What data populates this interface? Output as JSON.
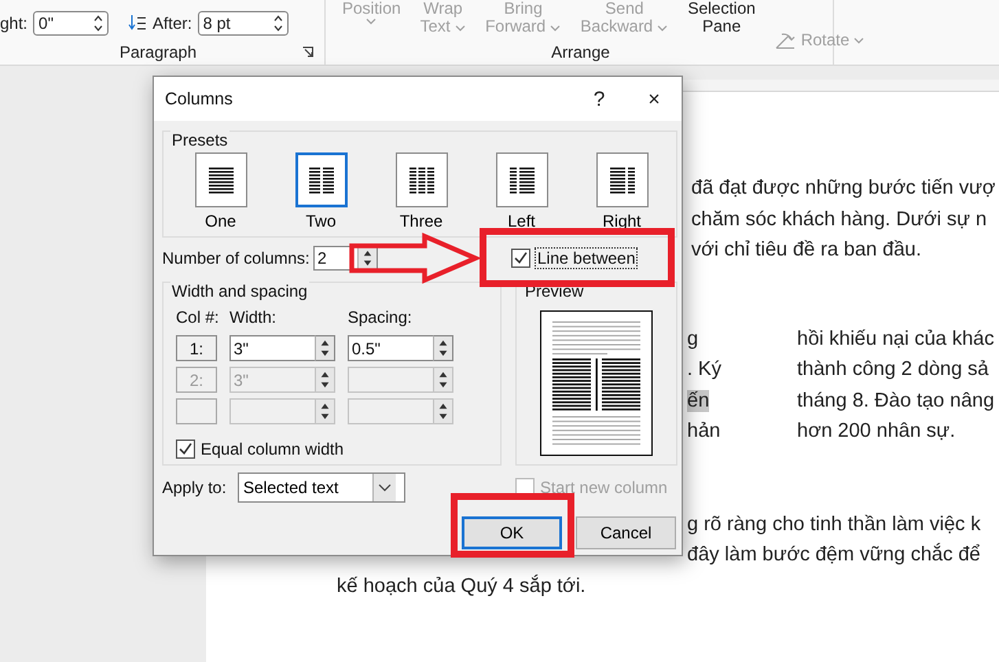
{
  "ribbon": {
    "paragraph": {
      "indent": {
        "label": "ght:",
        "value": "0\""
      },
      "spacing_after": {
        "label": "After:",
        "value": "8 pt"
      },
      "group_label": "Paragraph"
    },
    "arrange": {
      "group_label": "Arrange",
      "buttons": [
        {
          "kind": "stacked",
          "lines": [
            "Position"
          ],
          "dropdown": true,
          "disabled": true
        },
        {
          "kind": "stacked",
          "lines": [
            "Wrap",
            "Text"
          ],
          "dropdown": true,
          "disabled": true
        },
        {
          "kind": "stacked",
          "lines": [
            "Bring",
            "Forward"
          ],
          "dropdown": true,
          "disabled": true
        },
        {
          "kind": "stacked",
          "lines": [
            "Send",
            "Backward"
          ],
          "dropdown": true,
          "disabled": true
        },
        {
          "kind": "stacked",
          "lines": [
            "Selection",
            "Pane"
          ],
          "dropdown": false,
          "disabled": false
        },
        {
          "kind": "inline",
          "lines": [
            "Rotate"
          ],
          "dropdown": true,
          "disabled": true
        }
      ]
    }
  },
  "document": {
    "intro_lines": [
      "đã đạt được những bước tiến vượ",
      "chăm sóc khách hàng. Dưới sự n",
      "với chỉ tiêu đề ra ban đầu."
    ],
    "columns": {
      "left": [
        {
          "text": "g",
          "highlighted": false
        },
        {
          "text": ". Ký",
          "highlighted": false
        },
        {
          "text": "ến",
          "highlighted": true
        },
        {
          "text": "hản",
          "highlighted": false
        }
      ],
      "right": [
        "hồi khiếu nại của khác",
        "thành công 2 dòng sả",
        "tháng 8. Đào tạo nâng",
        "hơn 200 nhân sự."
      ]
    },
    "closing_lines": [
      {
        "kind": "fragment",
        "text": "g rõ ràng cho tinh thần làm việc k"
      },
      {
        "kind": "fragment",
        "text": "đây làm bước đệm vững chắc để"
      },
      {
        "kind": "full",
        "text": "kế hoạch của Quý 4 sắp tới."
      }
    ]
  },
  "dialog": {
    "title": "Columns",
    "help": "?",
    "close": "×",
    "presets": {
      "label": "Presets",
      "items": [
        {
          "kind": "one",
          "label": "One",
          "selected": false
        },
        {
          "kind": "two",
          "label": "Two",
          "selected": true
        },
        {
          "kind": "three",
          "label": "Three",
          "selected": false
        },
        {
          "kind": "left",
          "label": "Left",
          "selected": false
        },
        {
          "kind": "right",
          "label": "Right",
          "selected": false
        }
      ]
    },
    "number_of_columns": {
      "label": "Number of columns:",
      "value": "2"
    },
    "line_between": {
      "label": "Line between",
      "checked": true
    },
    "width_spacing": {
      "label": "Width and spacing",
      "headers": [
        "Col #:",
        "Width:",
        "Spacing:"
      ],
      "rows": [
        {
          "col": "1:",
          "width": "3\"",
          "spacing": "0.5\"",
          "disabled": false
        },
        {
          "col": "2:",
          "width": "3\"",
          "disabled": true
        },
        {
          "disabled": true
        }
      ],
      "equal_width": {
        "label": "Equal column width",
        "checked": true
      }
    },
    "preview": {
      "label": "Preview"
    },
    "apply_to": {
      "label": "Apply to:",
      "value": "Selected text"
    },
    "start_new_column": {
      "label": "Start new column",
      "checked": false,
      "disabled": true
    },
    "buttons": [
      {
        "label": "OK",
        "default": true
      },
      {
        "label": "Cancel",
        "default": false
      }
    ]
  },
  "annotations": [
    {
      "kind": "arrow"
    },
    {
      "kind": "frame"
    },
    {
      "kind": "frame"
    }
  ]
}
